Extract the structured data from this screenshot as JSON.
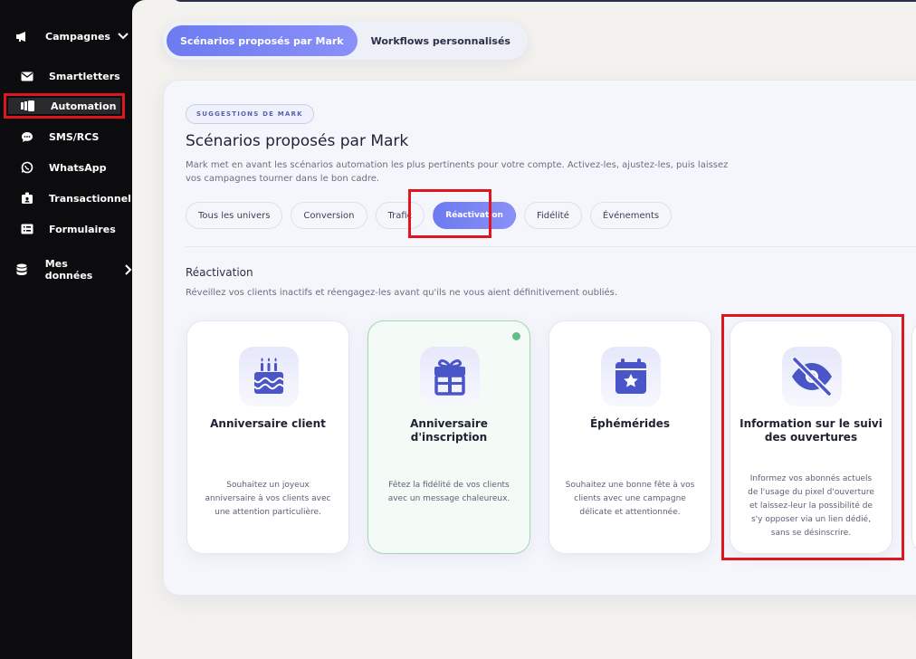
{
  "sidebar": {
    "campagnes": "Campagnes",
    "items": [
      {
        "label": "Smartletters"
      },
      {
        "label": "Automation"
      },
      {
        "label": "SMS/RCS"
      },
      {
        "label": "WhatsApp"
      },
      {
        "label": "Transactionnel"
      },
      {
        "label": "Formulaires"
      }
    ],
    "mes_donnees": "Mes données"
  },
  "tabs": [
    {
      "label": "Scénarios proposés par Mark",
      "active": true
    },
    {
      "label": "Workflows personnalisés",
      "active": false
    }
  ],
  "panel": {
    "tag": "SUGGESTIONS DE MARK",
    "title": "Scénarios proposés par Mark",
    "description": "Mark met en avant les scénarios automation les plus pertinents pour votre compte. Activez-les, ajustez-les, puis laissez vos campagnes tourner dans le bon cadre.",
    "filters": [
      "Tous les univers",
      "Conversion",
      "Trafic",
      "Réactivation",
      "Fidélité",
      "Événements"
    ],
    "active_filter": "Réactivation",
    "section_title": "Réactivation",
    "section_desc": "Réveillez vos clients inactifs et réengagez-les avant qu'ils ne vous aient définitivement oubliés.",
    "cards": [
      {
        "title": "Anniversaire client",
        "desc": "Souhaitez un joyeux anniversaire à vos clients avec une attention particulière.",
        "icon": "cake-icon"
      },
      {
        "title": "Anniversaire d'inscription",
        "desc": "Fêtez la fidélité de vos clients avec un message chaleureux.",
        "icon": "gift-icon"
      },
      {
        "title": "Éphémérides",
        "desc": "Souhaitez une bonne fête à vos clients avec une campagne délicate et attentionnée.",
        "icon": "calendar-star-icon"
      },
      {
        "title": "Information sur le suivi des ouvertures",
        "desc": "Informez vos abonnés actuels de l'usage du pixel d'ouverture et laissez-leur la possibilité de s'y opposer via un lien dédié, sans se désinscrire.",
        "icon": "eye-off-icon"
      }
    ]
  },
  "colors": {
    "accent": "#6c7bf0",
    "highlight": "#e0161f",
    "selected_dot": "#5fbf86",
    "icon": "#4a55c8"
  }
}
